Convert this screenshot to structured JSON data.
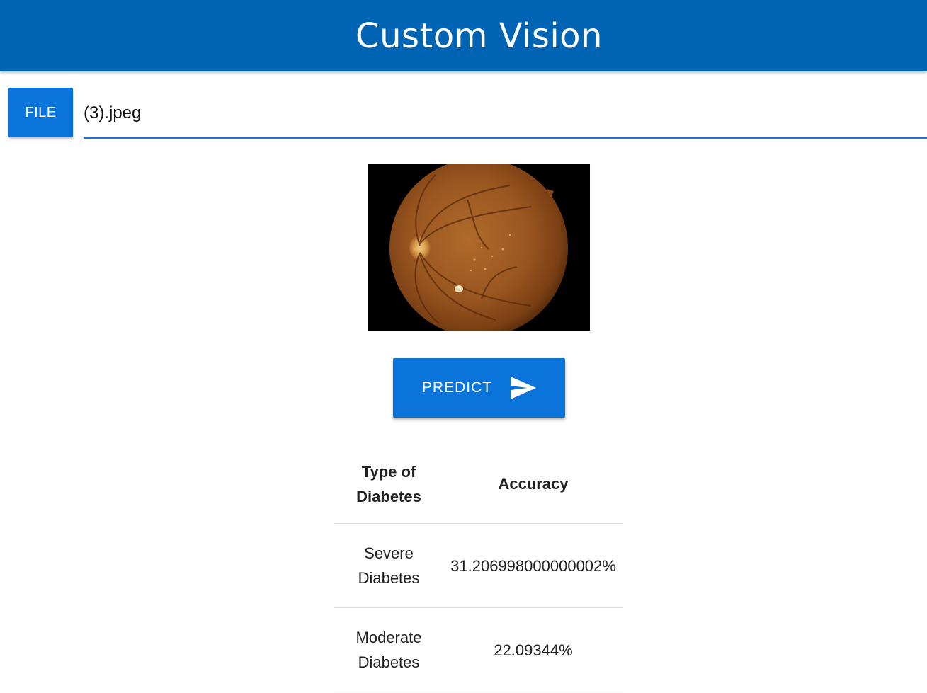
{
  "header": {
    "title": "Custom Vision",
    "background": "#0064b4"
  },
  "file_input": {
    "button_label": "FILE",
    "file_name": "(3).jpeg"
  },
  "preview": {
    "description_icon": "retina-fundus-image"
  },
  "predict": {
    "label": "PREDICT",
    "icon": "send-icon"
  },
  "results": {
    "headers": {
      "type": "Type of Diabetes",
      "accuracy": "Accuracy"
    },
    "rows": [
      {
        "type": "Severe Diabetes",
        "accuracy": "31.206998000000002%"
      },
      {
        "type": "Moderate Diabetes",
        "accuracy": "22.09344%"
      }
    ]
  },
  "colors": {
    "accent": "#0a74db",
    "underline": "#1a78d0"
  }
}
